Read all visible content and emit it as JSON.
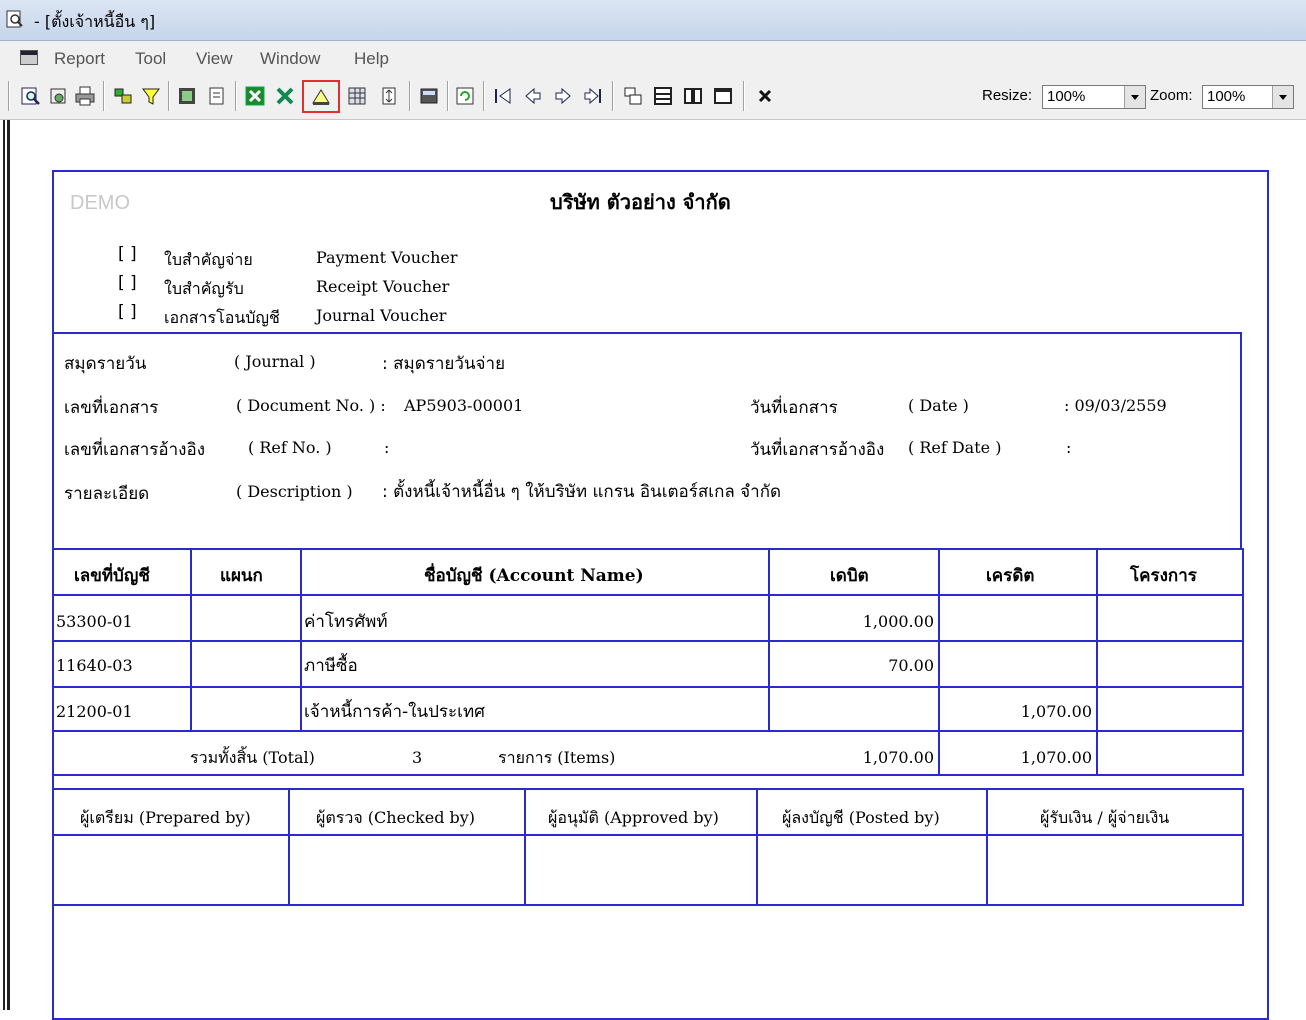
{
  "window": {
    "title": "- [ตั้งเจ้าหนี้อืน ๆ]"
  },
  "menu": [
    "Report",
    "Tool",
    "View",
    "Window",
    "Help"
  ],
  "toolbar": {
    "buttons": [
      "preview-icon",
      "setup-icon",
      "print-icon",
      "filter-group-icon",
      "filter-icon",
      "export-icon",
      "export-text-icon",
      "excel-icon",
      "excel-export-icon",
      "design-icon",
      "grid-icon",
      "resize-icon",
      "calculator-icon",
      "refresh-icon",
      "first-page-icon",
      "prev-page-icon",
      "next-page-icon",
      "last-page-icon",
      "tile-icon",
      "rows-icon",
      "columns-icon",
      "window-icon",
      "close-icon"
    ],
    "resize_label": "Resize:",
    "resize_value": "100%",
    "zoom_label": "Zoom:",
    "zoom_value": "100%"
  },
  "report": {
    "watermark": "DEMO",
    "company": "บริษัท ตัวอย่าง จำกัด",
    "voucher_types": [
      {
        "check": "[ ]",
        "thai": "ใบสำคัญจ่าย",
        "eng": "Payment Voucher"
      },
      {
        "check": "[ ]",
        "thai": "ใบสำคัญรับ",
        "eng": "Receipt Voucher"
      },
      {
        "check": "[ ]",
        "thai": "เอกสารโอนบัญชี",
        "eng": "Journal Voucher"
      }
    ],
    "info": {
      "journal_th": "สมุดรายวัน",
      "journal_en": "( Journal )",
      "journal_value": ":  สมุดรายวันจ่าย",
      "docno_th": "เลขที่เอกสาร",
      "docno_en": "( Document No. ) :",
      "docno_value": "AP5903-00001",
      "date_th": "วันที่เอกสาร",
      "date_en": "( Date )",
      "date_value": ":   09/03/2559",
      "refno_th": "เลขที่เอกสารอ้างอิง",
      "refno_en": "( Ref No. )",
      "refno_colon": ":",
      "refdate_th": "วันที่เอกสารอ้างอิง",
      "refdate_en": "( Ref Date )",
      "refdate_colon": ":",
      "desc_th": "รายละเอียด",
      "desc_en": "( Description )",
      "desc_value": ":  ตั้งหนี้เจ้าหนี้อื่น ๆ ให้บริษัท แกรน อินเตอร์สเกล จำกัด"
    },
    "table": {
      "headers": [
        "เลขที่บัญชี",
        "แผนก",
        "ชื่อบัญชี (Account Name)",
        "เดบิต",
        "เครดิต",
        "โครงการ"
      ],
      "rows": [
        {
          "account": "53300-01",
          "dept": "",
          "name": "ค่าโทรศัพท์",
          "debit": "1,000.00",
          "credit": "",
          "project": ""
        },
        {
          "account": "11640-03",
          "dept": "",
          "name": "ภาษีซื้อ",
          "debit": "70.00",
          "credit": "",
          "project": ""
        },
        {
          "account": "21200-01",
          "dept": "",
          "name": "เจ้าหนี้การค้า-ในประเทศ",
          "debit": "",
          "credit": "1,070.00",
          "project": ""
        }
      ],
      "total_label": "รวมทั้งสิ้น (Total)",
      "total_count": "3",
      "items_label": "รายการ (Items)",
      "total_debit": "1,070.00",
      "total_credit": "1,070.00"
    },
    "signatures": [
      "ผู้เตรียม (Prepared by)",
      "ผู้ตรวจ (Checked by)",
      "ผู้อนุมัติ (Approved by)",
      "ผู้ลงบัญชี (Posted by)",
      "ผู้รับเงิน / ผู้จ่ายเงิน"
    ]
  }
}
